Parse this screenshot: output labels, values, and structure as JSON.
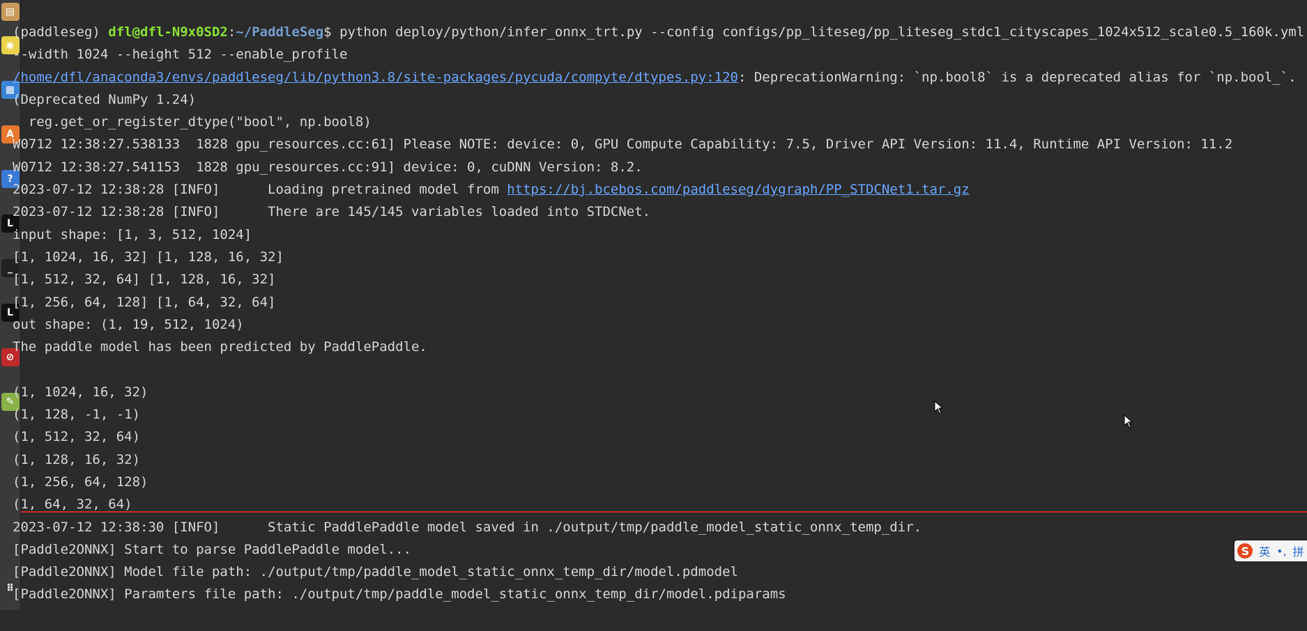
{
  "dock": {
    "items": [
      {
        "name": "files-app-icon",
        "glyph": "▤",
        "color": "#c89b5a"
      },
      {
        "name": "disc-app-icon",
        "glyph": "◉",
        "color": "#e8d24a"
      },
      {
        "name": "document-app-icon",
        "glyph": "▦",
        "color": "#3b83d6"
      },
      {
        "name": "software-center-icon",
        "glyph": "A",
        "color": "#e8772e"
      },
      {
        "name": "help-icon",
        "glyph": "?",
        "color": "#3a7ad6"
      },
      {
        "name": "ide-app-icon",
        "glyph": "L",
        "color": "#111111"
      },
      {
        "name": "terminal-app-icon",
        "glyph": "_",
        "color": "#222222"
      },
      {
        "name": "ide-alt-app-icon",
        "glyph": "L",
        "color": "#111111"
      },
      {
        "name": "settings-app-icon",
        "glyph": "⊘",
        "color": "#c12a2a"
      },
      {
        "name": "image-viewer-app-icon",
        "glyph": "✎",
        "color": "#8ab04a"
      }
    ],
    "show_apps_glyph": "⠿"
  },
  "terminal": {
    "prompt": {
      "env": "(paddleseg) ",
      "user_host": "dfl@dfl-N9x0SD2",
      "sep": ":",
      "path": "~/PaddleSeg",
      "dollar": "$ ",
      "command": "python deploy/python/infer_onnx_trt.py --config configs/pp_liteseg/pp_liteseg_stdc1_cityscapes_1024x512_scale0.5_160k.yml"
    },
    "lines": [
      "--width 1024 --height 512 --enable_profile",
      "",
      "(Deprecated NumPy 1.24)",
      "  reg.get_or_register_dtype(\"bool\", np.bool8)",
      "W0712 12:38:27.538133  1828 gpu_resources.cc:61] Please NOTE: device: 0, GPU Compute Capability: 7.5, Driver API Version: 11.4, Runtime API Version: 11.2",
      "W0712 12:38:27.541153  1828 gpu_resources.cc:91] device: 0, cuDNN Version: 8.2.",
      "",
      "2023-07-12 12:38:28 [INFO]\tThere are 145/145 variables loaded into STDCNet.",
      "input shape: [1, 3, 512, 1024]",
      "[1, 1024, 16, 32] [1, 128, 16, 32]",
      "[1, 512, 32, 64] [1, 128, 16, 32]",
      "[1, 256, 64, 128] [1, 64, 32, 64]",
      "out shape: (1, 19, 512, 1024)",
      "The paddle model has been predicted by PaddlePaddle.",
      " ",
      "(1, 1024, 16, 32)",
      "(1, 128, -1, -1)",
      "(1, 512, 32, 64)",
      "(1, 128, 16, 32)",
      "(1, 256, 64, 128)",
      "(1, 64, 32, 64)",
      "2023-07-12 12:38:30 [INFO]\tStatic PaddlePaddle model saved in ./output/tmp/paddle_model_static_onnx_temp_dir.",
      "[Paddle2ONNX] Start to parse PaddlePaddle model...",
      "[Paddle2ONNX] Model file path: ./output/tmp/paddle_model_static_onnx_temp_dir/model.pdmodel",
      "[Paddle2ONNX] Paramters file path: ./output/tmp/paddle_model_static_onnx_temp_dir/model.pdiparams"
    ],
    "warning_line": {
      "link": "/home/dfl/anaconda3/envs/paddleseg/lib/python3.8/site-packages/pycuda/compyte/dtypes.py:120",
      "text": ": DeprecationWarning: `np.bool8` is a deprecated alias for `np.bool_`."
    },
    "loading_line": {
      "prefix": "2023-07-12 12:38:28 [INFO]\tLoading pretrained model from ",
      "link": "https://bj.bcebos.com/paddleseg/dygraph/PP_STDCNet1.tar.gz"
    }
  },
  "ime": {
    "logo": "S",
    "lang": "英",
    "punct": "•,",
    "mode": "拼"
  }
}
